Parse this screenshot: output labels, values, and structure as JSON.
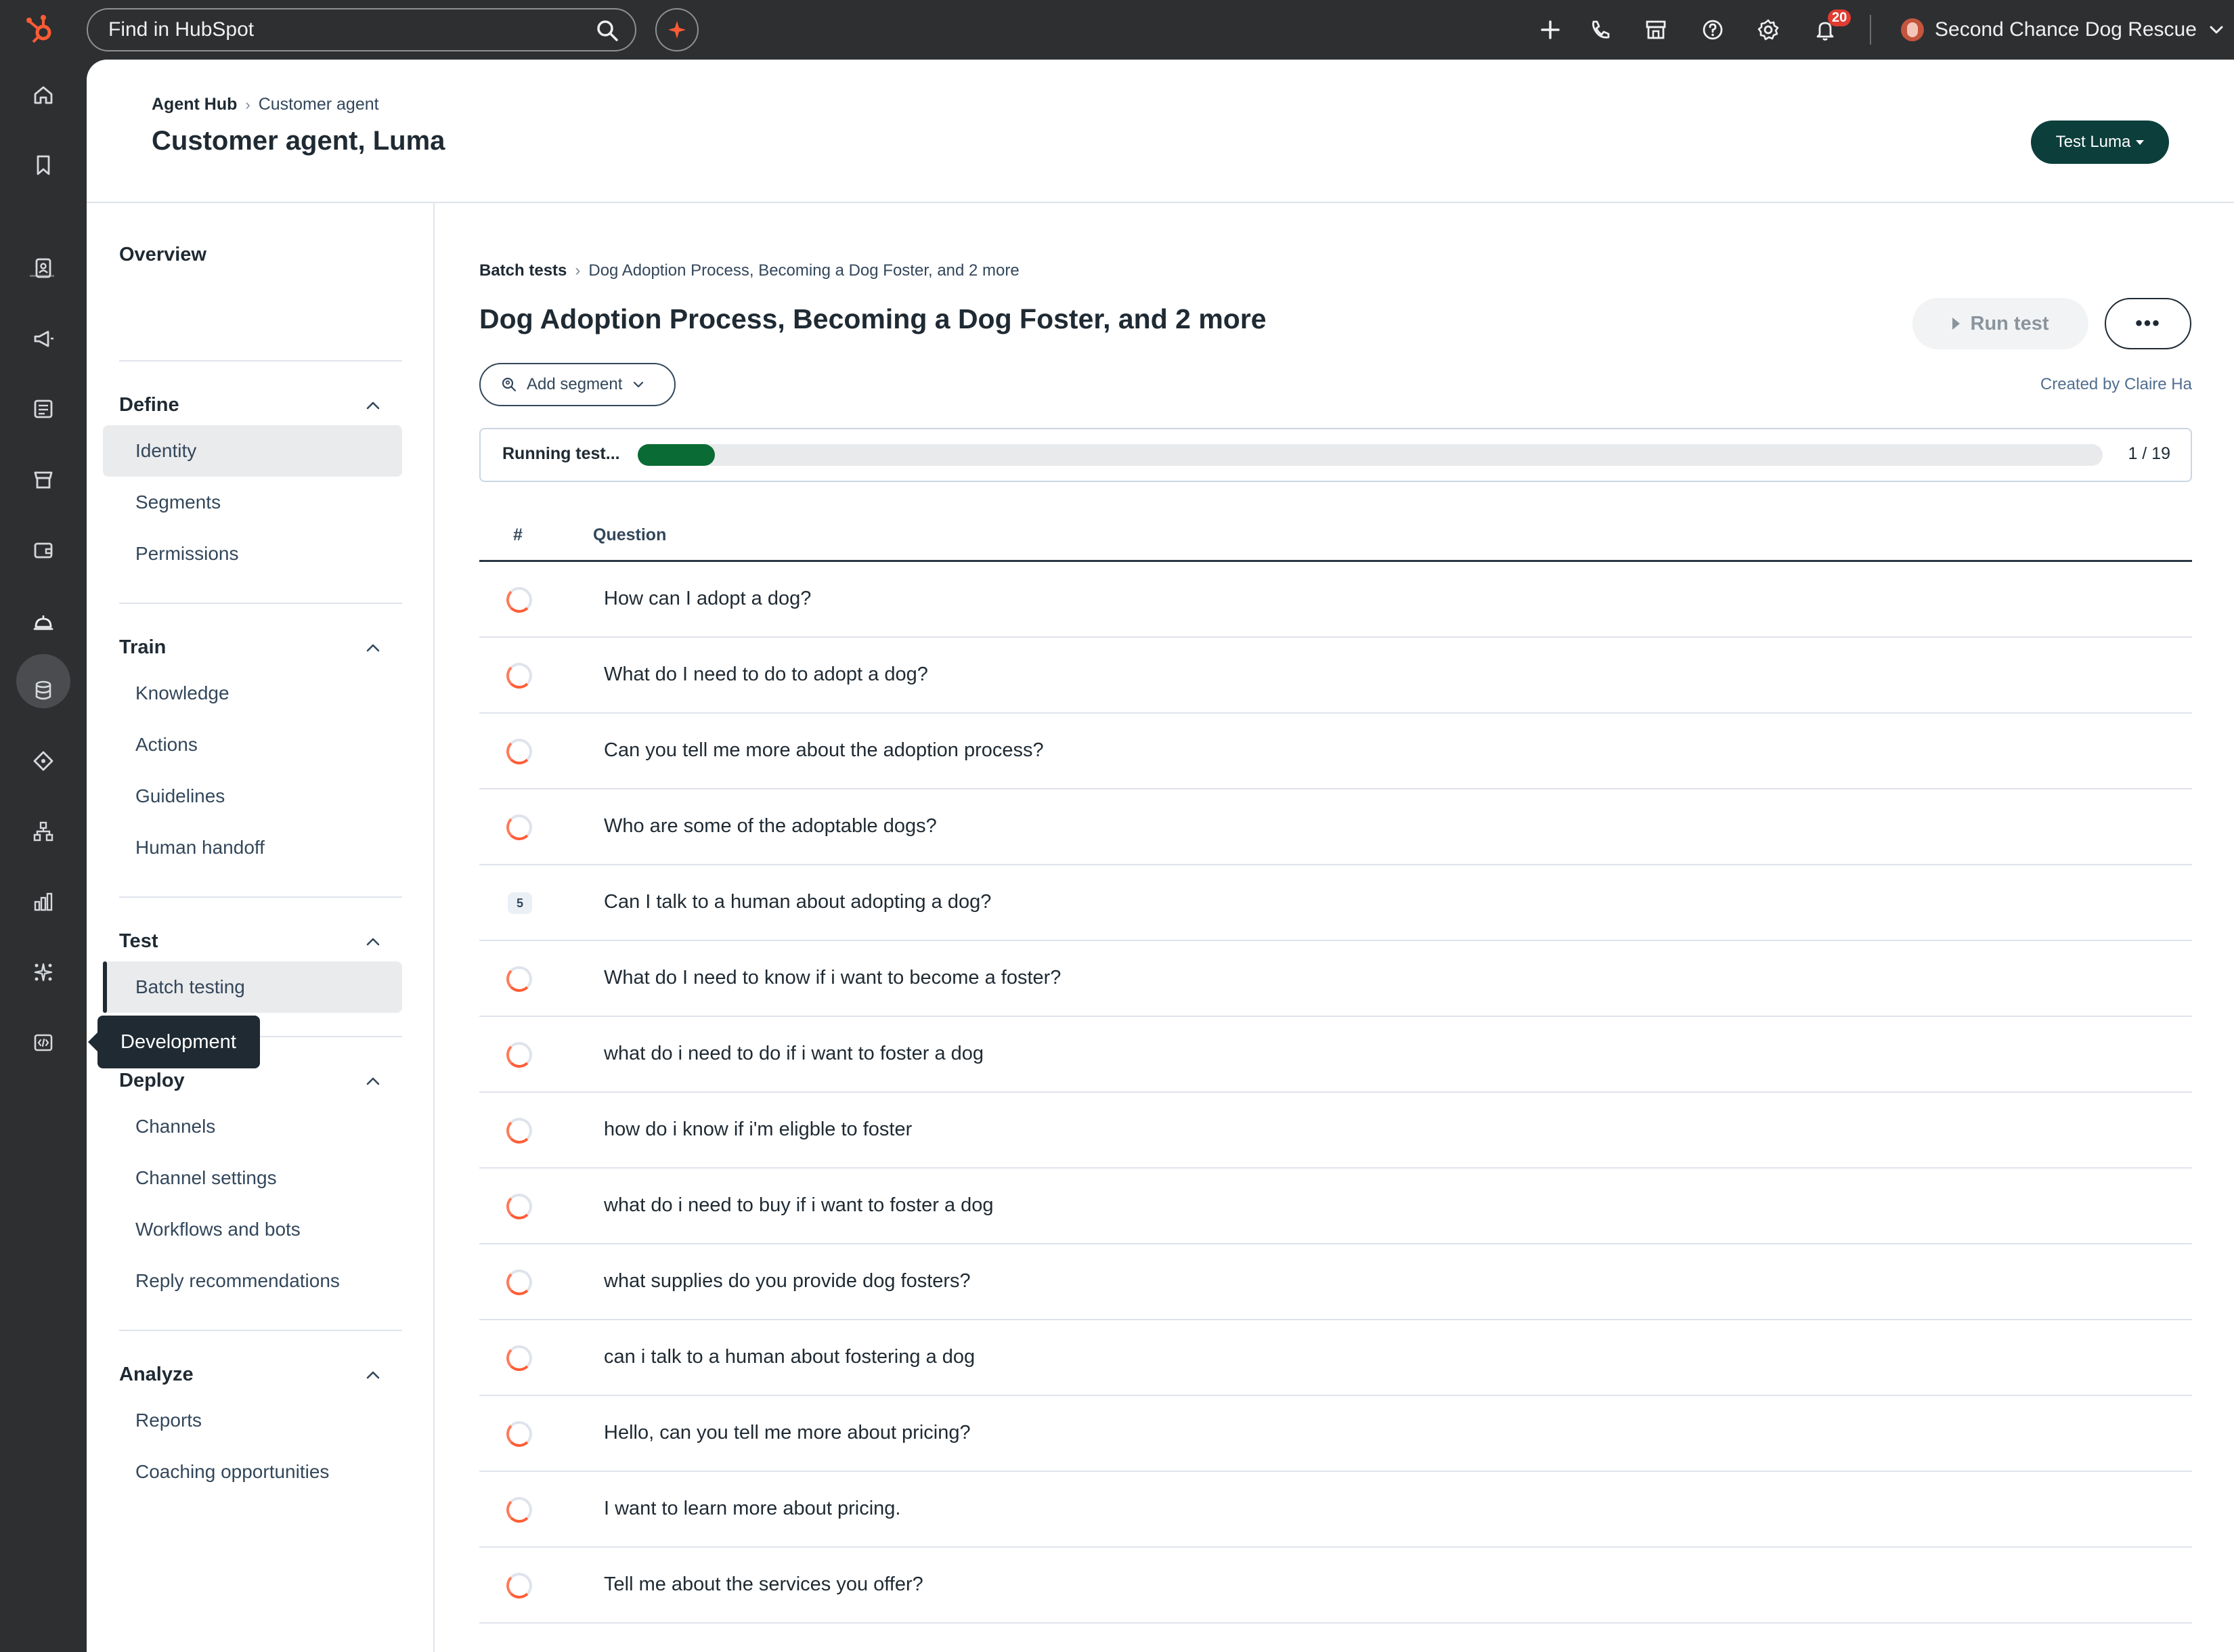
{
  "topbar": {
    "search_placeholder": "Find in HubSpot",
    "notifications_count": "20",
    "account_name": "Second Chance Dog Rescue"
  },
  "header": {
    "breadcrumb_root": "Agent Hub",
    "breadcrumb_current": "Customer agent",
    "title": "Customer agent, Luma",
    "test_button": "Test Luma"
  },
  "sidebar": {
    "overview": "Overview",
    "sections": [
      {
        "title": "Define",
        "items": [
          "Identity",
          "Segments",
          "Permissions"
        ]
      },
      {
        "title": "Train",
        "items": [
          "Knowledge",
          "Actions",
          "Guidelines",
          "Human handoff"
        ]
      },
      {
        "title": "Test",
        "items": [
          "Batch testing"
        ]
      },
      {
        "title": "Deploy",
        "items": [
          "Channels",
          "Channel settings",
          "Workflows and bots",
          "Reply recommendations"
        ]
      },
      {
        "title": "Analyze",
        "items": [
          "Reports",
          "Coaching opportunities"
        ]
      }
    ],
    "tooltip": "Development"
  },
  "content": {
    "breadcrumb_root": "Batch tests",
    "breadcrumb_current": "Dog Adoption Process, Becoming a Dog Foster, and 2 more",
    "title": "Dog Adoption Process, Becoming a Dog Foster, and 2 more",
    "run_test": "Run test",
    "more": "•••",
    "add_segment": "Add segment",
    "created_by": "Created by Claire Ha",
    "progress_label": "Running test...",
    "progress_fraction": 0.0526,
    "progress_count": "1 / 19",
    "table_headers": {
      "num": "#",
      "question": "Question"
    },
    "questions": [
      {
        "status": "running",
        "num": "",
        "text": "How can I adopt a dog?"
      },
      {
        "status": "running",
        "num": "",
        "text": "What do I need to do to adopt a dog?"
      },
      {
        "status": "running",
        "num": "",
        "text": "Can you tell me more about the adoption process?"
      },
      {
        "status": "running",
        "num": "",
        "text": "Who are some of the adoptable dogs?"
      },
      {
        "status": "number",
        "num": "5",
        "text": "Can I talk to a human about adopting a dog?"
      },
      {
        "status": "running",
        "num": "",
        "text": "What do I need to know if i want to become a foster?"
      },
      {
        "status": "running",
        "num": "",
        "text": "what do i need to do if i want to foster a dog"
      },
      {
        "status": "running",
        "num": "",
        "text": "how do i know if i'm eligble to foster"
      },
      {
        "status": "running",
        "num": "",
        "text": "what do i need to buy if i want to foster a dog"
      },
      {
        "status": "running",
        "num": "",
        "text": "what supplies do you provide dog fosters?"
      },
      {
        "status": "running",
        "num": "",
        "text": "can i talk to a human about fostering a dog"
      },
      {
        "status": "running",
        "num": "",
        "text": "Hello, can you tell me more about pricing?"
      },
      {
        "status": "running",
        "num": "",
        "text": "I want to learn more about pricing."
      },
      {
        "status": "running",
        "num": "",
        "text": "Tell me about the services you offer?"
      }
    ]
  },
  "colors": {
    "brand_orange": "#ff5c35",
    "dark_teal": "#0c3e3b",
    "progress_green": "#0a6b34",
    "chrome_dark": "#2e2f31"
  },
  "icons": {
    "topbar": [
      "hubspot-logo-icon",
      "search-icon",
      "copilot-icon",
      "plus-icon",
      "phone-icon",
      "marketplace-icon",
      "help-icon",
      "settings-icon",
      "bell-icon"
    ],
    "leftnav": [
      "home-icon",
      "bookmark-icon",
      "contacts-icon",
      "marketing-icon",
      "content-icon",
      "commerce-icon",
      "wallet-icon",
      "service-icon",
      "data-icon",
      "automation-icon",
      "org-chart-icon",
      "reporting-icon",
      "breeze-icon",
      "development-icon"
    ]
  }
}
